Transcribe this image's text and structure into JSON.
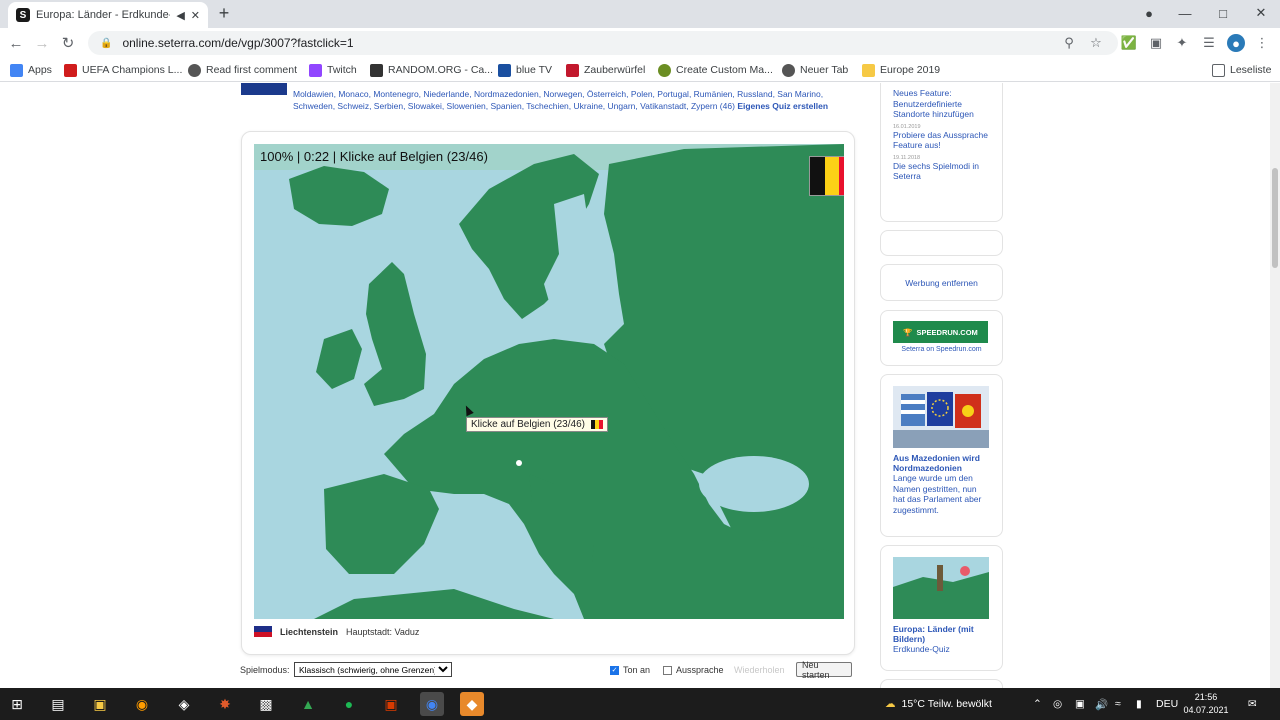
{
  "browser": {
    "tab_title": "Europa: Länder - Erdkunde-Q",
    "tab_favicon": "S",
    "url": "online.seterra.com/de/vgp/3007?fastclick=1",
    "bookmarks": [
      {
        "label": "Apps",
        "icon": "apps-grid-icon",
        "color": "#4285f4"
      },
      {
        "label": "UEFA Champions L...",
        "icon": "srf-icon",
        "color": "#d01c1c"
      },
      {
        "label": "Read first comment",
        "icon": "globe-icon",
        "color": "#555555"
      },
      {
        "label": "Twitch",
        "icon": "twitch-icon",
        "color": "#9146ff"
      },
      {
        "label": "RANDOM.ORG - Ca...",
        "icon": "random-org-icon",
        "color": "#333333"
      },
      {
        "label": "blue TV",
        "icon": "blue-tv-icon",
        "color": "#1a4fa0"
      },
      {
        "label": "Zauberwürfel",
        "icon": "cube-icon",
        "color": "#c2182d"
      },
      {
        "label": "Create Custom Ma...",
        "icon": "map-icon",
        "color": "#6b8e23"
      },
      {
        "label": "Neuer Tab",
        "icon": "globe-icon",
        "color": "#555555"
      },
      {
        "label": "Europe 2019",
        "icon": "folder-icon",
        "color": "#f6c945"
      }
    ],
    "reading_list": "Leseliste"
  },
  "page": {
    "country_list_text": "Moldawien, Monaco, Montenegro, Niederlande, Nordmazedonien, Norwegen, Österreich, Polen, Portugal, Rumänien, Russland, San Marino, Schweden, Schweiz, Serbien, Slowakei, Slowenien, Spanien, Tschechien, Ukraine, Ungarn, Vatikanstadt, Zypern (46)",
    "custom_quiz_link": "Eigenes Quiz erstellen",
    "game": {
      "hud": "100% | 0:22 | Klicke auf Belgien (23/46)",
      "tooltip": "Klicke auf Belgien (23/46)",
      "target_flag_colors": [
        "#111111",
        "#fcd116",
        "#e8112d"
      ],
      "last_country": "Liechtenstein",
      "last_capital": "Hauptstadt: Vaduz",
      "last_flag_colors": [
        "#1e2e88",
        "#ce1126"
      ],
      "map_land_color": "#2e8b57",
      "map_sea_color": "#a9d6e0"
    },
    "controls": {
      "mode_label": "Spielmodus:",
      "mode_value": "Klassisch (schwierig, ohne Grenzen)",
      "sound_label": "Ton an",
      "sound_checked": true,
      "pronounce_label": "Aussprache",
      "pronounce_checked": false,
      "repeat_label": "Wiederholen",
      "restart_label": "Neu starten"
    }
  },
  "sidebar": {
    "news": [
      {
        "date": "",
        "text": "Neues Feature: Benutzerdefinierte Standorte hinzufügen"
      },
      {
        "date": "16.01.2019",
        "text": "Probiere das Aussprache Feature aus!"
      },
      {
        "date": "19.11.2018",
        "text": "Die sechs Spielmodi in Seterra"
      }
    ],
    "remove_ads": "Werbung entfernen",
    "speedrun_banner": "SPEEDRUN.COM",
    "speedrun_text": "Seterra on Speedrun.com",
    "article_title": "Aus Mazedonien wird Nordmazedonien",
    "article_desc": "Lange wurde um den Namen gestritten, nun hat das Parlament aber zugestimmt.",
    "quiz_title": "Europa: Länder (mit Bildern)",
    "quiz_desc": "Erdkunde-Quiz"
  },
  "taskbar": {
    "weather": "15°C Teilw. bewölkt",
    "language": "DEU",
    "time": "21:56",
    "date": "04.07.2021"
  }
}
